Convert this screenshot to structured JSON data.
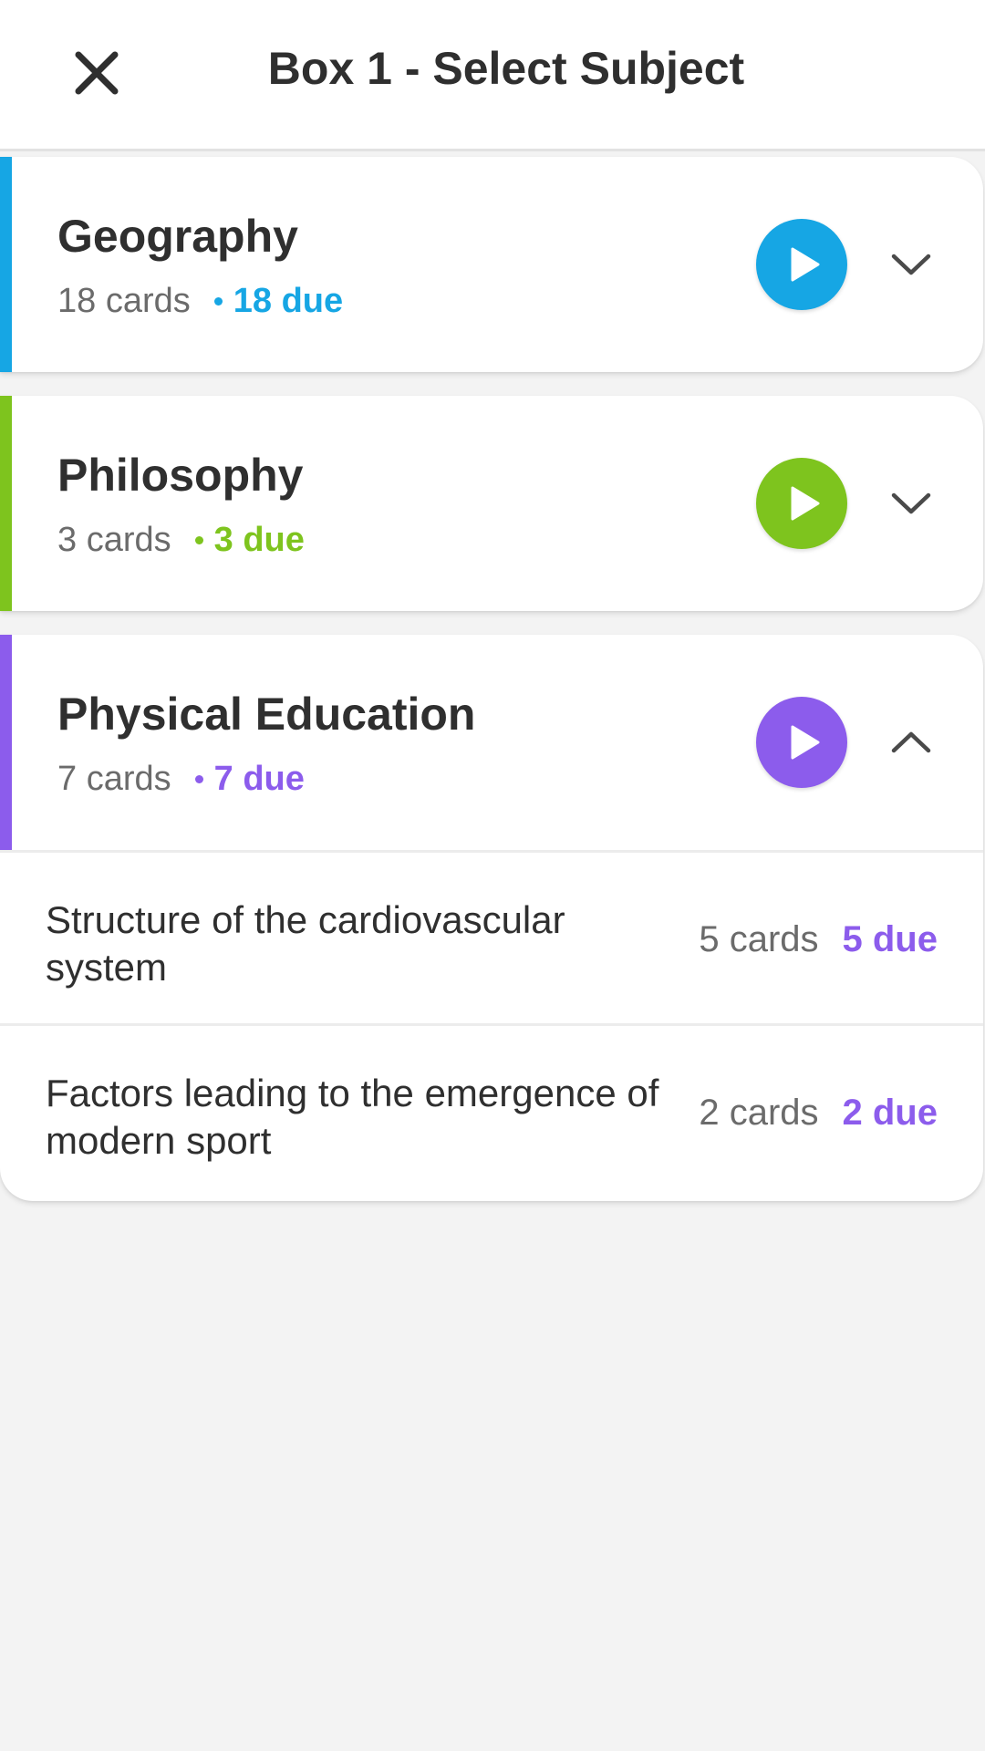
{
  "header": {
    "title": "Box 1 - Select Subject",
    "close_icon": "close-icon"
  },
  "subjects": [
    {
      "name": "Geography",
      "cards": "18 cards",
      "due": "18 due",
      "color": "#16a6e4",
      "expanded": false
    },
    {
      "name": "Philosophy",
      "cards": "3 cards",
      "due": "3 due",
      "color": "#7ec41e",
      "expanded": false
    },
    {
      "name": "Physical Education",
      "cards": "7 cards",
      "due": "7 due",
      "color": "#8c5cec",
      "expanded": true,
      "topics": [
        {
          "title": "Structure of the cardiovascular system",
          "cards": "5 cards",
          "due": "5 due"
        },
        {
          "title": "Factors leading to the emergence of modern sport",
          "cards": "2 cards",
          "due": "2 due"
        }
      ]
    }
  ],
  "icons": {
    "play": "play-icon",
    "chevron_down": "chevron-down-icon",
    "chevron_up": "chevron-up-icon"
  }
}
